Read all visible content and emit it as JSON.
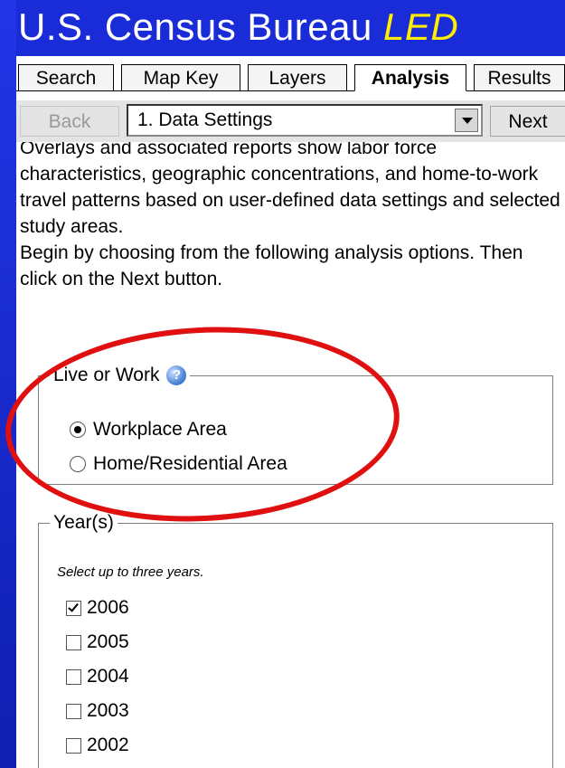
{
  "header": {
    "title_main": "U.S. Census Bureau ",
    "title_accent": "LED"
  },
  "tabs": [
    {
      "label": "Search"
    },
    {
      "label": "Map Key"
    },
    {
      "label": "Layers"
    },
    {
      "label": "Analysis",
      "active": true
    },
    {
      "label": "Results"
    }
  ],
  "nav": {
    "back_label": "Back",
    "step_select": "1. Data Settings",
    "next_label": "Next"
  },
  "intro": {
    "paragraph1": "Overlays and associated reports show labor force characteristics, geographic concentrations, and home-to-work travel patterns based on user-defined data settings and selected study areas.",
    "paragraph2": "Begin by choosing from the following analysis options. Then click on the Next button."
  },
  "live_or_work": {
    "legend": "Live or Work",
    "help_icon": "?",
    "options": [
      {
        "label": "Workplace Area",
        "selected": true
      },
      {
        "label": "Home/Residential Area",
        "selected": false
      }
    ]
  },
  "years": {
    "legend": "Year(s)",
    "hint": "Select up to three years.",
    "options": [
      {
        "label": "2006",
        "checked": true
      },
      {
        "label": "2005",
        "checked": false
      },
      {
        "label": "2004",
        "checked": false
      },
      {
        "label": "2003",
        "checked": false
      },
      {
        "label": "2002",
        "checked": false
      }
    ]
  },
  "colors": {
    "background": "#1a2bd8",
    "title_accent": "#ffee00",
    "highlight": "#e01010"
  }
}
